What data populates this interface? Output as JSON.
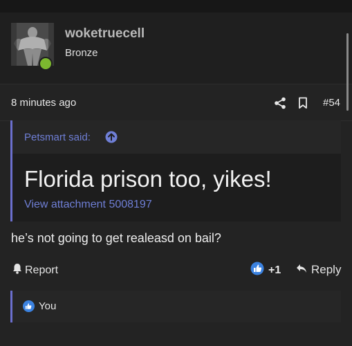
{
  "author": {
    "username": "woketruecell",
    "rank": "Bronze"
  },
  "meta": {
    "timestamp": "8 minutes ago",
    "post_number": "#54"
  },
  "quote": {
    "author_label": "Petsmart said:",
    "text": "Florida prison too, yikes!",
    "attachment_link": "View attachment 5008197"
  },
  "post": {
    "body": "he’s not going to get realeasd on bail?"
  },
  "actions": {
    "report_label": "Report",
    "like_count": "+1",
    "reply_label": "Reply"
  },
  "reactions": {
    "summary": "You"
  },
  "colors": {
    "accent": "#6b6fce",
    "online": "#7cb82f",
    "like": "#3b82e0"
  },
  "icons": [
    "share-icon",
    "bookmark-icon",
    "arrow-up-circle-icon",
    "bell-icon",
    "like-icon",
    "reply-icon"
  ]
}
